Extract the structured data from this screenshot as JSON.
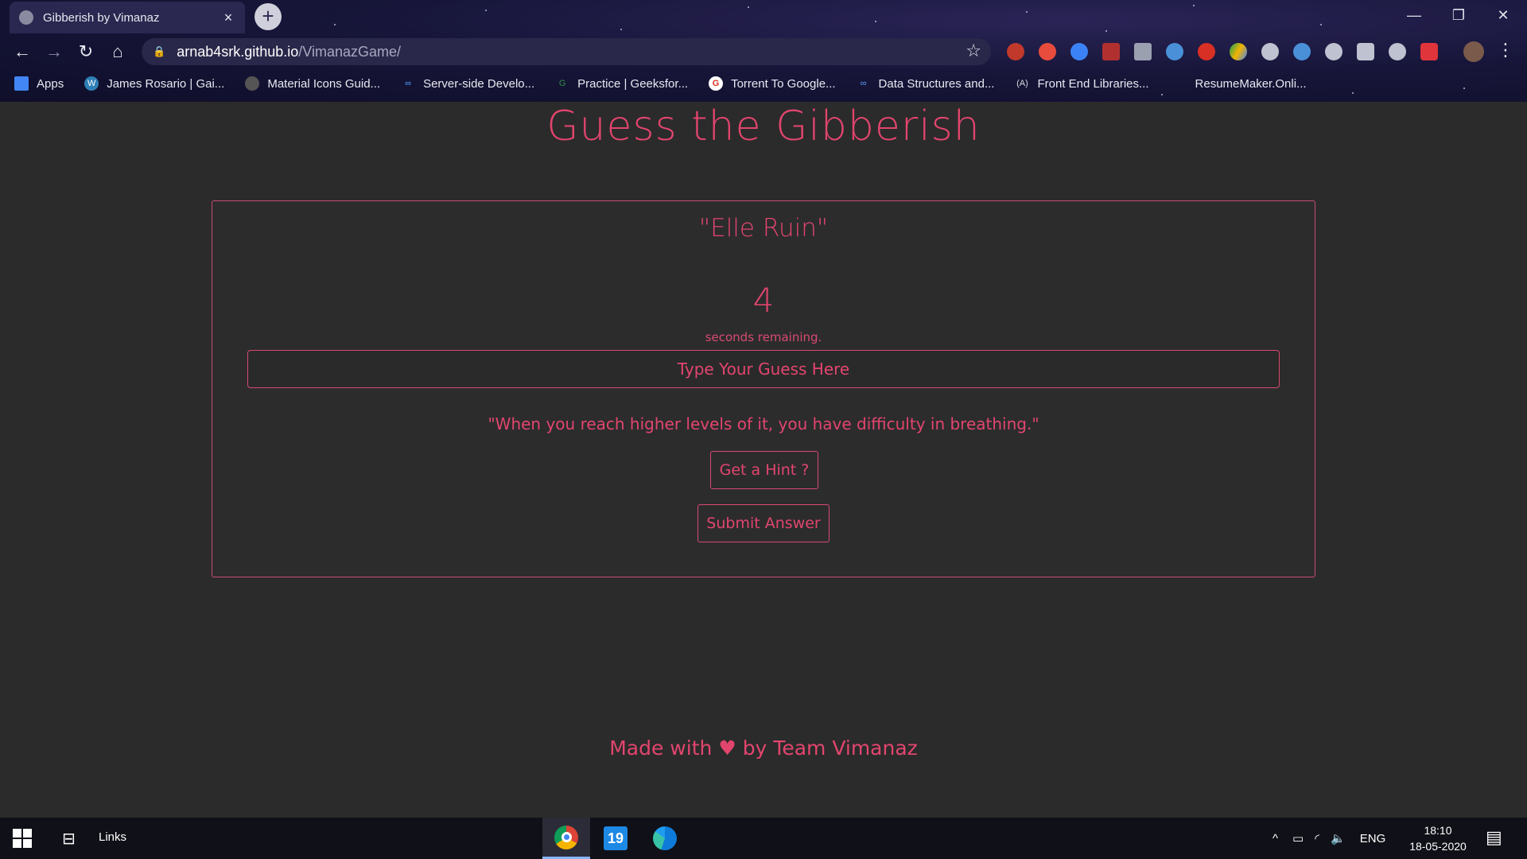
{
  "browser": {
    "tab": {
      "title": "Gibberish by Vimanaz"
    },
    "url": {
      "host": "arnab4srk.github.io",
      "path": "/VimanazGame/"
    },
    "bookmarks": [
      {
        "label": "Apps",
        "icon": "apps-grid-icon",
        "color": "#4285f4"
      },
      {
        "label": "James Rosario | Gai...",
        "icon": "wordpress-icon",
        "color": "#2f7fb5"
      },
      {
        "label": "Material Icons Guid...",
        "icon": "material-icon",
        "color": "#444444"
      },
      {
        "label": "Server-side Develo...",
        "icon": "infinity-icon",
        "color": "#5aa0ff"
      },
      {
        "label": "Practice | Geeksfor...",
        "icon": "geeksforgeeks-icon",
        "color": "#2f8d46"
      },
      {
        "label": "Torrent To Google...",
        "icon": "google-icon",
        "color": "#ffffff"
      },
      {
        "label": "Data Structures and...",
        "icon": "infinity-icon",
        "color": "#5aa0ff"
      },
      {
        "label": "Front End Libraries...",
        "icon": "freecodecamp-icon",
        "color": "#dddddd"
      },
      {
        "label": "ResumeMaker.Onli...",
        "icon": "",
        "color": ""
      }
    ]
  },
  "page": {
    "title": "Guess the Gibberish",
    "gibberish": "\"Elle Ruin\"",
    "timer": {
      "value": "4",
      "label": "seconds remaining."
    },
    "guess_placeholder": "Type Your Guess Here",
    "hint": "\"When you reach higher levels of it, you have difficulty in breathing.\"",
    "buttons": {
      "hint": "Get a Hint ?",
      "submit": "Submit Answer"
    },
    "footer": {
      "before": "Made with",
      "heart": "♥",
      "after": "by Team Vimanaz"
    },
    "accent_color": "#e2456e"
  },
  "taskbar": {
    "links_label": "Links",
    "apps": [
      "chrome-icon",
      "calendar-19-icon",
      "edge-icon"
    ],
    "language": "ENG",
    "time": "18:10",
    "date": "18-05-2020"
  }
}
